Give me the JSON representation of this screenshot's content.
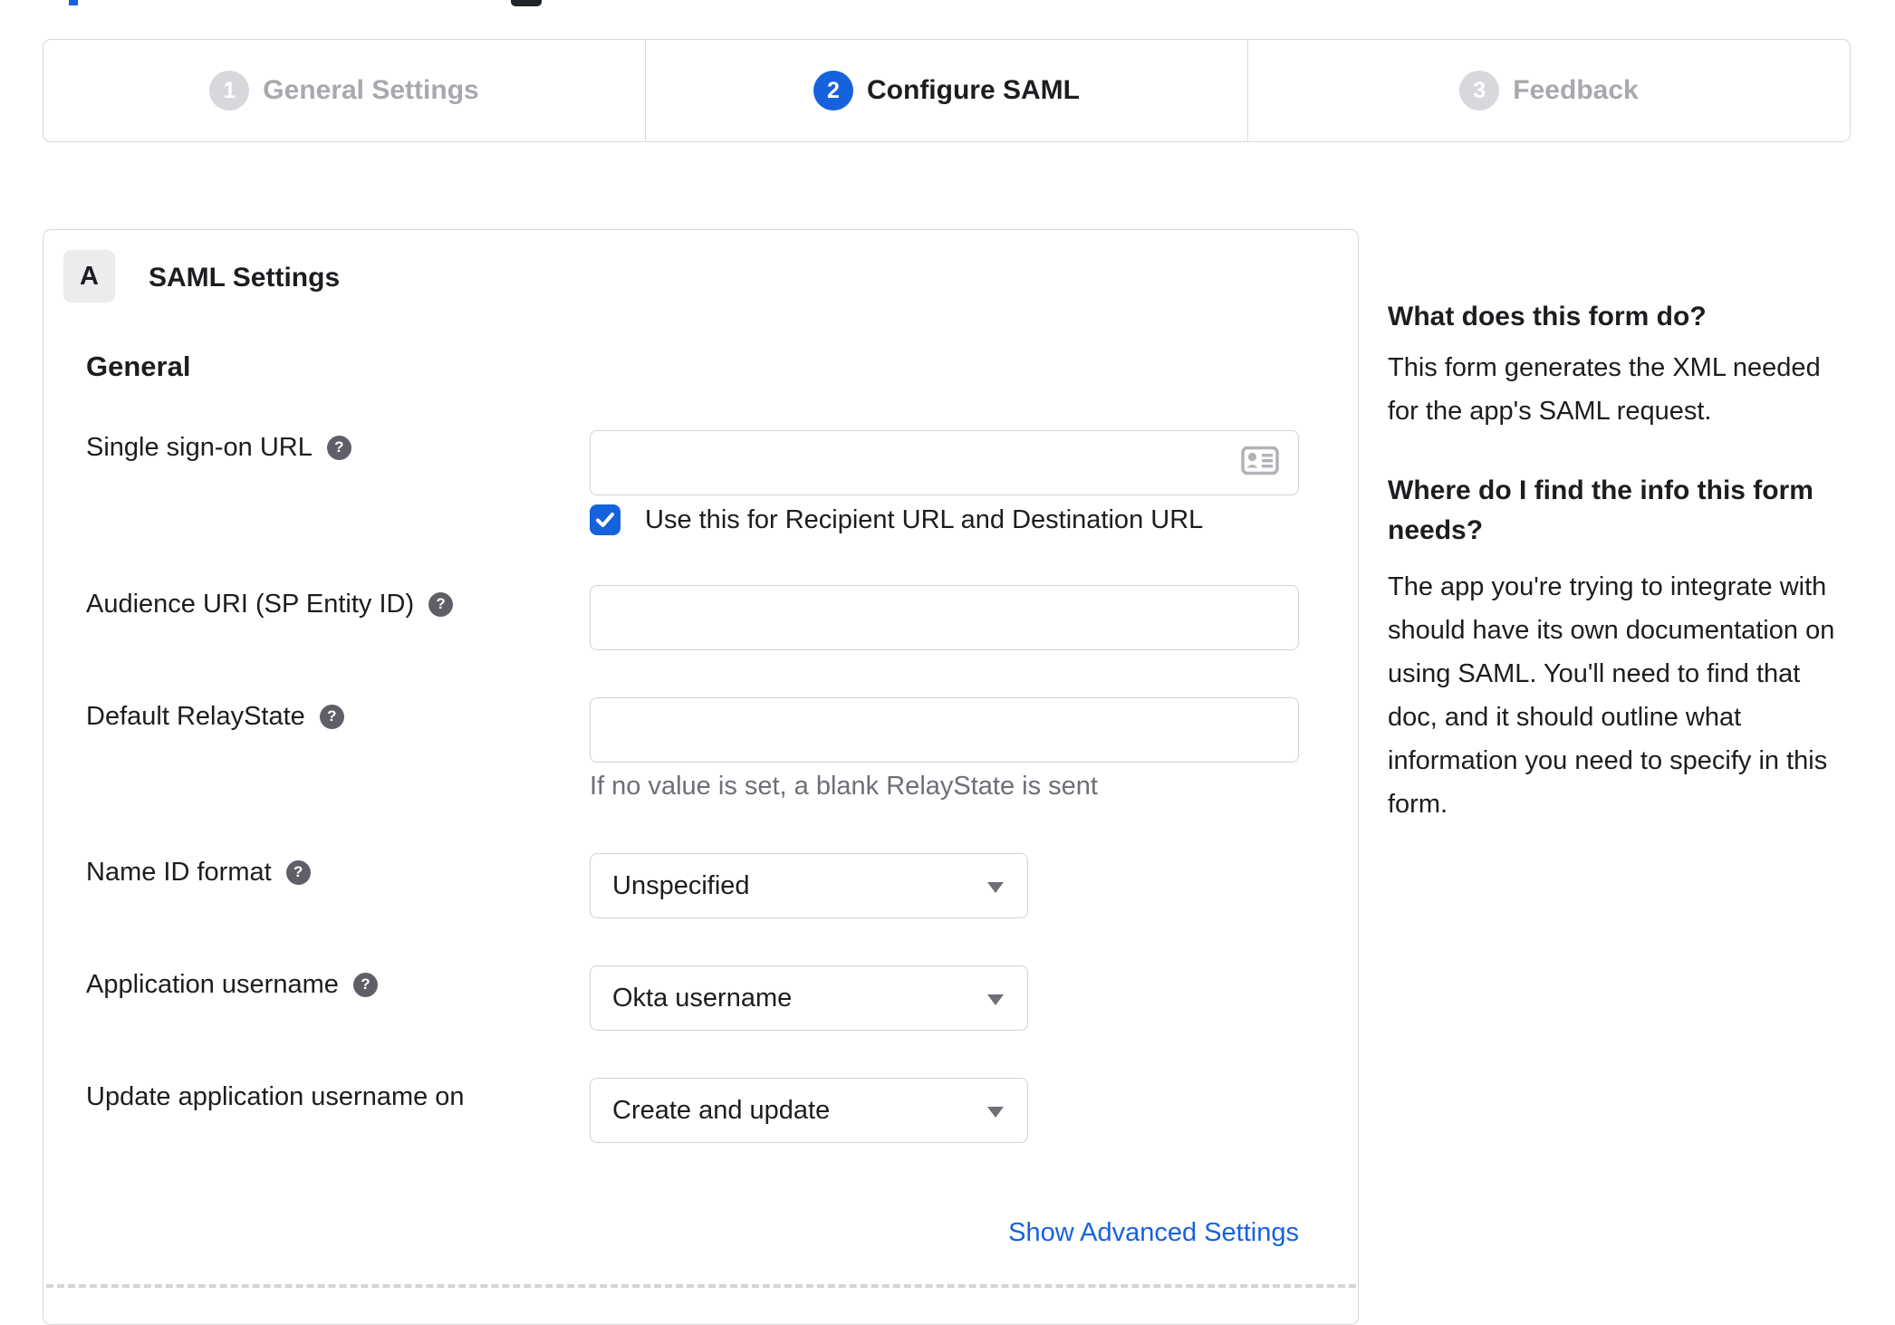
{
  "colors": {
    "accent_blue": "#1662dd",
    "border_gray": "#d8d8dc",
    "inactive_step_gray": "#d8d8dc",
    "inactive_label_gray": "#a8a8af",
    "text_dark": "#1d1d21",
    "hint_gray": "#6e6e78",
    "help_icon_bg": "#5f5f68",
    "badge_bg": "#ececee",
    "card_icon_gray": "#b2b2b8",
    "link_blue": "#1662dd"
  },
  "stepper": {
    "steps": [
      {
        "number": "1",
        "label": "General Settings",
        "state": "inactive"
      },
      {
        "number": "2",
        "label": "Configure SAML",
        "state": "active"
      },
      {
        "number": "3",
        "label": "Feedback",
        "state": "inactive"
      }
    ]
  },
  "panel": {
    "section_badge": "A",
    "section_title": "SAML Settings",
    "group_heading": "General",
    "fields": {
      "sso": {
        "label": "Single sign-on URL",
        "value": ""
      },
      "sso_checkbox": {
        "label": "Use this for Recipient URL and Destination URL",
        "checked": true
      },
      "audience": {
        "label": "Audience URI (SP Entity ID)",
        "value": ""
      },
      "relay": {
        "label": "Default RelayState",
        "value": "",
        "hint": "If no value is set, a blank RelayState is sent"
      },
      "name_id": {
        "label": "Name ID format",
        "value": "Unspecified"
      },
      "app_username": {
        "label": "Application username",
        "value": "Okta username"
      },
      "update_username": {
        "label": "Update application username on",
        "value": "Create and update"
      }
    },
    "advanced_link": "Show Advanced Settings"
  },
  "sidebar": {
    "sections": [
      {
        "heading": "What does this form do?",
        "body": "This form generates the XML needed for the app's SAML request."
      },
      {
        "heading": "Where do I find the info this form needs?",
        "body": "The app you're trying to integrate with should have its own documentation on using SAML. You'll need to find that doc, and it should outline what information you need to specify in this form."
      }
    ]
  },
  "icons": {
    "help_glyph": "?"
  }
}
